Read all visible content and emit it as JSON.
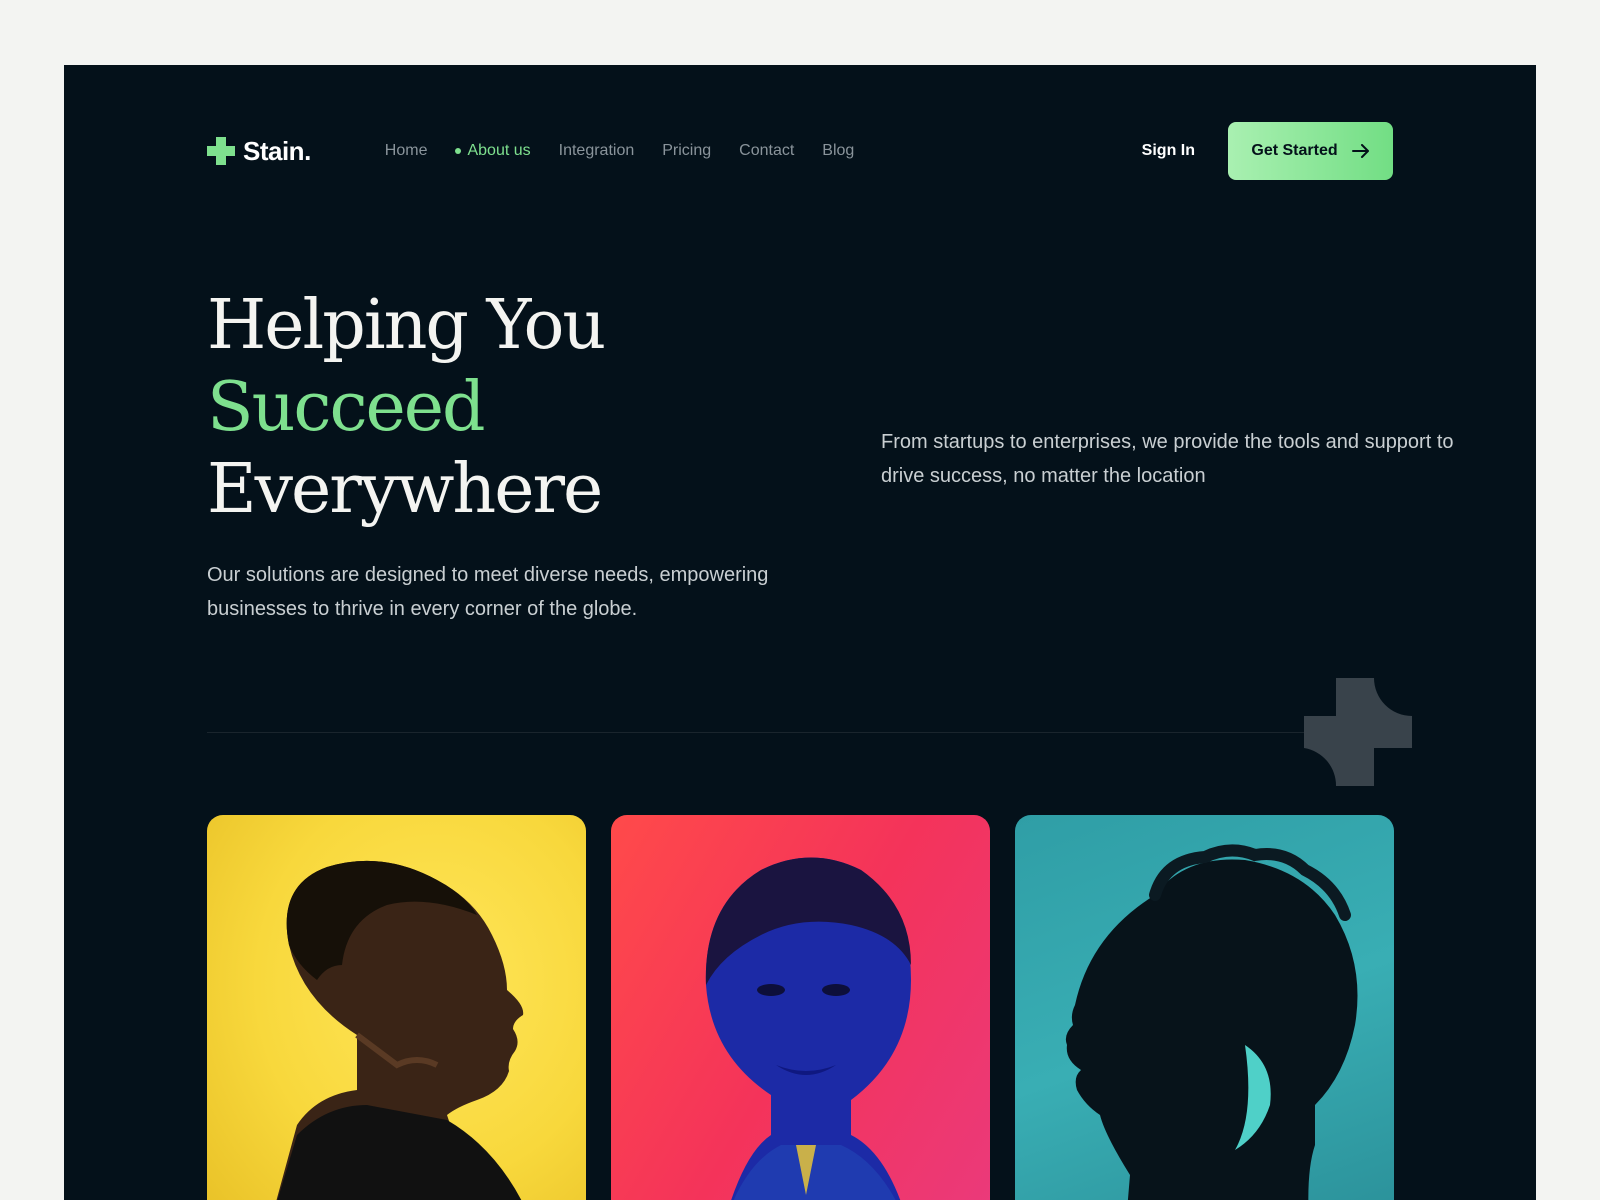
{
  "brand": {
    "name": "Stain."
  },
  "nav": {
    "links": [
      {
        "label": "Home",
        "active": false
      },
      {
        "label": "About us",
        "active": true
      },
      {
        "label": "Integration",
        "active": false
      },
      {
        "label": "Pricing",
        "active": false
      },
      {
        "label": "Contact",
        "active": false
      },
      {
        "label": "Blog",
        "active": false
      }
    ],
    "sign_in": "Sign In",
    "get_started": "Get Started"
  },
  "hero": {
    "title_line1": "Helping You",
    "title_line2": "Succeed",
    "title_line3": "Everywhere",
    "subtitle": "Our solutions are designed to meet diverse needs, empowering businesses to thrive in every corner of the globe.",
    "side_text": "From startups to enterprises, we provide the tools and support to drive success, no matter the location"
  },
  "icons": {
    "logo": "plus-blob-logo-icon",
    "arrow": "arrow-right-icon",
    "decor": "plus-blob-decor-icon"
  },
  "colors": {
    "background": "#04111a",
    "accent": "#7ee08e",
    "card_yellow": "#f8d83c",
    "card_red": "#f4335a",
    "card_teal": "#39aeb4"
  }
}
